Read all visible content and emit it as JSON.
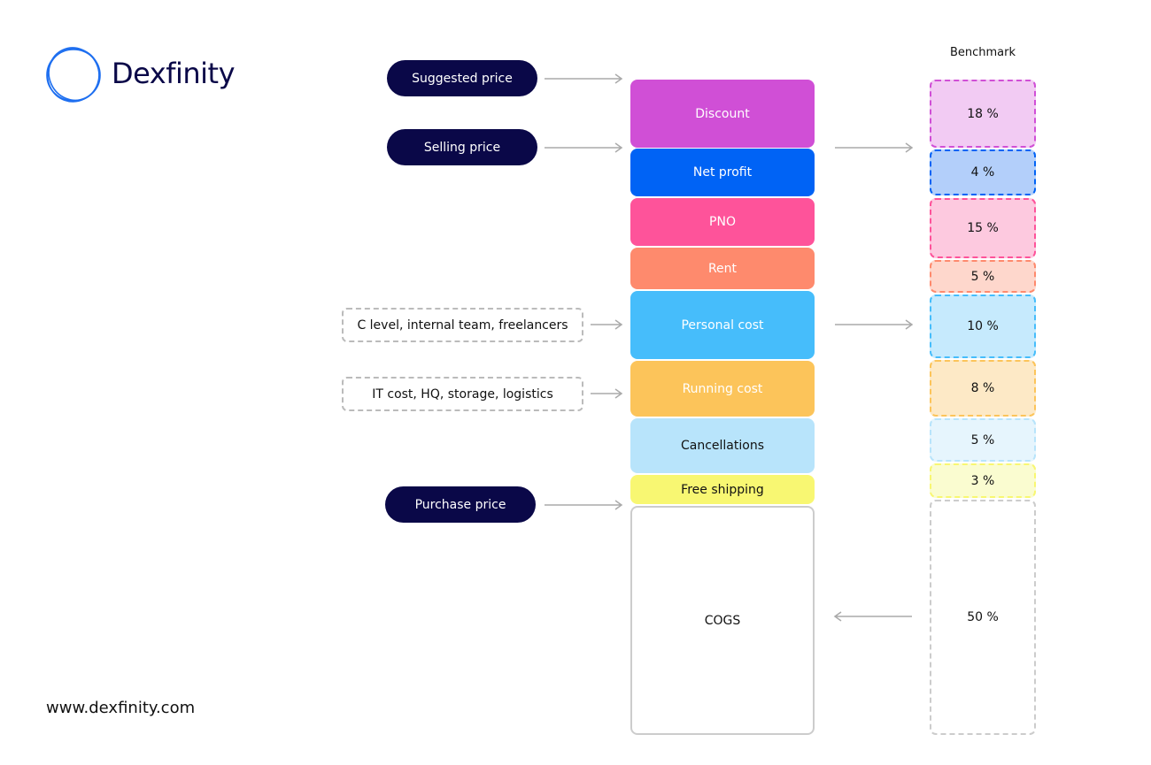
{
  "brand": {
    "name": "Dexfinity",
    "website": "www.dexfinity.com",
    "accent": "#0a0848"
  },
  "benchmark_title": "Benchmark",
  "labels": {
    "suggested": "Suggested price",
    "selling": "Selling price",
    "purchase": "Purchase price"
  },
  "notes": {
    "personal": "C level, internal team, freelancers",
    "running": "IT cost, HQ, storage, logistics"
  },
  "blocks": [
    {
      "label": "Discount",
      "color": "#d04fd6",
      "benchmark": "18 %"
    },
    {
      "label": "Net profit",
      "color": "#0063f5",
      "benchmark": "4 %"
    },
    {
      "label": "PNO",
      "color": "#fe539a",
      "benchmark": "15 %"
    },
    {
      "label": "Rent",
      "color": "#fe8a6d",
      "benchmark": "5 %"
    },
    {
      "label": "Personal cost",
      "color": "#46bdfb",
      "benchmark": "10 %"
    },
    {
      "label": "Running cost",
      "color": "#fcc45a",
      "benchmark": "8 %"
    },
    {
      "label": "Cancellations",
      "color": "#b8e4fb",
      "benchmark": "5 %"
    },
    {
      "label": "Free shipping",
      "color": "#f8f772",
      "benchmark": "3 %"
    },
    {
      "label": "COGS",
      "color": "#ffffff",
      "benchmark": "50 %"
    }
  ]
}
